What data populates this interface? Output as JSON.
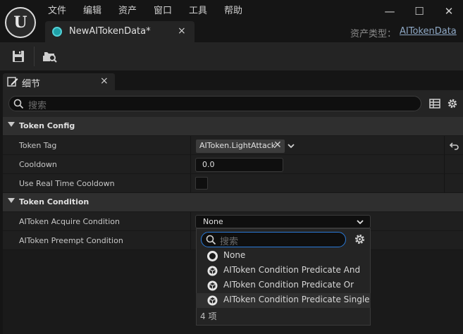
{
  "menu": {
    "items": [
      "文件",
      "编辑",
      "资产",
      "窗口",
      "工具",
      "帮助"
    ]
  },
  "window": {
    "minimize": "—",
    "maximize": "☐",
    "close": "✕"
  },
  "document_tab": {
    "title": "NewAITokenData*",
    "close": "×"
  },
  "asset_type": {
    "label": "资产类型：",
    "value": "AITokenData"
  },
  "details_tab": {
    "title": "细节",
    "close": "×"
  },
  "search": {
    "placeholder": "搜索"
  },
  "categories": [
    {
      "name": "Token Config",
      "rows": [
        {
          "label": "Token Tag",
          "value": "AIToken.LightAttack"
        },
        {
          "label": "Cooldown",
          "value": "0.0"
        },
        {
          "label": "Use Real Time Cooldown",
          "checked": false
        }
      ]
    },
    {
      "name": "Token Condition",
      "rows": [
        {
          "label": "AIToken Acquire Condition",
          "value": "None"
        },
        {
          "label": "AIToken Preempt Condition"
        }
      ]
    }
  ],
  "dropdown": {
    "search_placeholder": "搜索",
    "options": [
      "None",
      "AIToken Condition Predicate And",
      "AIToken Condition Predicate Or",
      "AIToken Condition Predicate Single"
    ],
    "count": "4 项"
  },
  "colors": {
    "accent_teal": "#1fa1a8",
    "focus_blue": "#2a7ad9",
    "link": "#8fa9c6"
  },
  "icons": [
    "unreal-logo-icon",
    "save-icon",
    "browse-asset-icon",
    "pencil-icon",
    "search-icon",
    "table-view-icon",
    "settings-gear-icon",
    "reset-arrow-icon",
    "chevron-down-icon",
    "class-icon"
  ]
}
